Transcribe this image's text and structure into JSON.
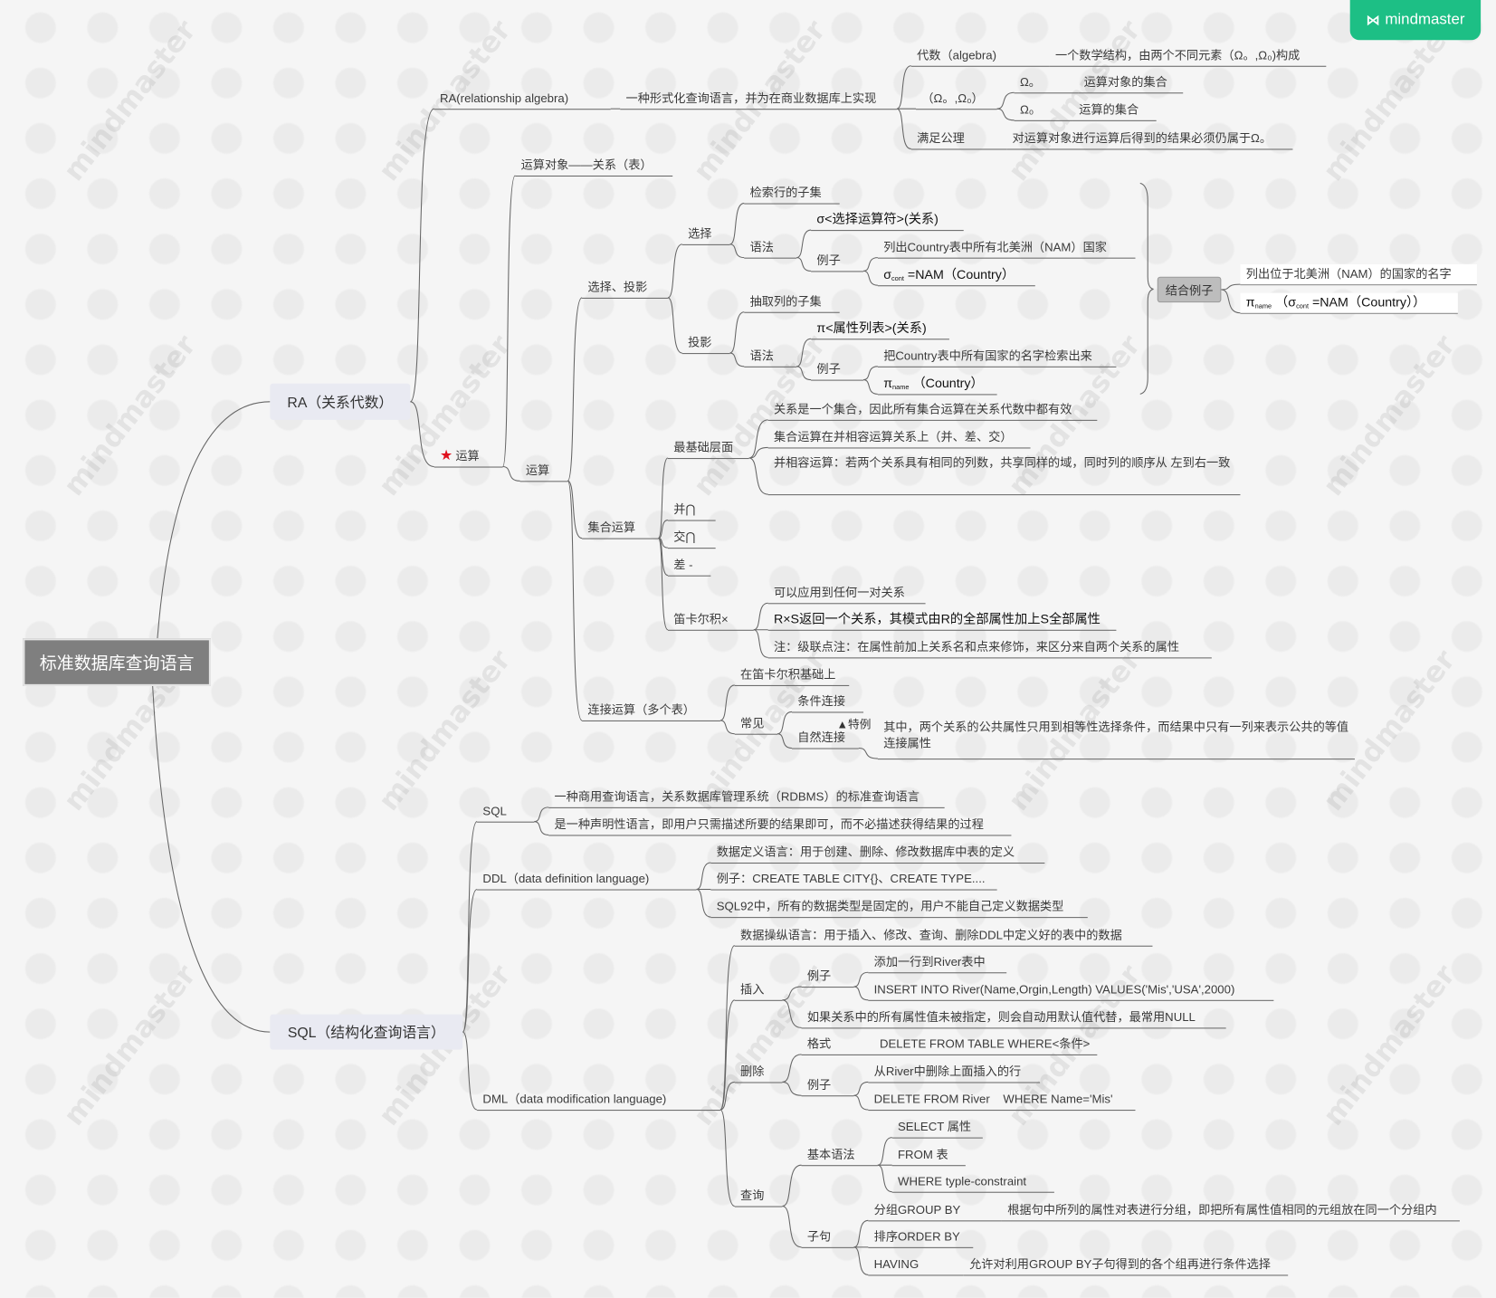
{
  "logo": {
    "text": "mindmaster",
    "icon": "mindmaster-logo-icon",
    "color": "#1dbf85"
  },
  "watermark": "mindmaster",
  "root": "标准数据库查询语言",
  "ra": {
    "label": "RA（关系代数）",
    "definition": {
      "label": "RA(relationship algebra)",
      "desc": "一种形式化查询语言，并为在商业数据库上实现",
      "algebra": {
        "label": "代数（algebra)",
        "desc": "一个数学结构，由两个不同元素（Ω。,Ω₀)构成"
      },
      "pair": {
        "label": "（Ω。,Ω₀）",
        "omega_a": {
          "symbol": "Ω。",
          "desc": "运算对象的集合"
        },
        "omega_0": {
          "symbol": "Ω₀",
          "desc": "运算的集合"
        }
      },
      "axiom": {
        "label": "满足公理",
        "desc": "对运算对象进行运算后得到的结果必须仍属于Ω。"
      }
    },
    "operations": {
      "label": "运算",
      "icon": "star-icon",
      "star_color": "#e0101d",
      "operand": "运算对象——关系（表）",
      "op": {
        "label": "运算",
        "select_project": {
          "label": "选择、投影",
          "select": {
            "label": "选择",
            "subset": "检索行的子集",
            "syntax": {
              "label": "语法",
              "formula": "σ<选择运算符>(关系)",
              "example": {
                "label": "例子",
                "desc": "列出Country表中所有北美洲（NAM）国家",
                "formula": {
                  "symbol": "σ",
                  "sub": "cont",
                  "rest": " =NAM（Country）"
                }
              }
            }
          },
          "project": {
            "label": "投影",
            "subset": "抽取列的子集",
            "syntax": {
              "label": "语法",
              "formula": "π<属性列表>(关系)",
              "example": {
                "label": "例子",
                "desc": "把Country表中所有国家的名字检索出来",
                "formula": {
                  "symbol": "π",
                  "sub": "name",
                  "rest": " （Country）"
                }
              }
            }
          },
          "combined": {
            "label": "结合例子",
            "desc": "列出位于北美洲（NAM）的国家的名字",
            "formula": {
              "symbol": "π",
              "sub": "name",
              "mid": " （σ",
              "sub2": "cont",
              "rest": " =NAM（Country））"
            }
          }
        },
        "set_ops": {
          "label": "集合运算",
          "basic": {
            "label": "最基础层面",
            "items": [
              "关系是一个集合，因此所有集合运算在关系代数中都有效",
              "集合运算在并相容运算关系上（并、差、交）",
              "并相容运算：若两个关系具有相同的列数，共享同样的域，同时列的顺序从 左到右一致"
            ]
          },
          "union": "并⋂",
          "intersect": "交⋂",
          "difference": "差 -",
          "cartesian": {
            "label": "笛卡尔积×",
            "items": [
              "可以应用到任何一对关系",
              "R×S返回一个关系，其模式由R的全部属性加上S全部属性",
              "注：级联点注：在属性前加上关系名和点来修饰，来区分来自两个关系的属性"
            ]
          }
        },
        "join": {
          "label": "连接运算（多个表）",
          "base": "在笛卡尔积基础上",
          "common": {
            "label": "常见",
            "conditional": "条件连接",
            "natural": "自然连接",
            "special_note": "▲特例",
            "natural_desc": "其中，两个关系的公共属性只用到相等性选择条件，而结果中只有一列来表示公共的等值连接属性"
          }
        }
      }
    }
  },
  "sql": {
    "label": "SQL（结构化查询语言）",
    "sql": {
      "label": "SQL",
      "items": [
        "一种商用查询语言，关系数据库管理系统（RDBMS）的标准查询语言",
        "是一种声明性语言，即用户只需描述所要的结果即可，而不必描述获得结果的过程"
      ]
    },
    "ddl": {
      "label": "DDL（data definition language)",
      "items": [
        "数据定义语言：用于创建、删除、修改数据库中表的定义",
        "例子：CREATE TABLE CITY{}、CREATE TYPE....",
        "SQL92中，所有的数据类型是固定的，用户不能自己定义数据类型"
      ]
    },
    "dml": {
      "label": "DML（data modification language)",
      "desc": "数据操纵语言：用于插入、修改、查询、删除DDL中定义好的表中的数据",
      "insert": {
        "label": "插入",
        "example": {
          "label": "例子",
          "items": [
            "添加一行到River表中",
            "INSERT INTO River(Name,Orgin,Length) VALUES('Mis','USA',2000)"
          ]
        },
        "note": "如果关系中的所有属性值未被指定，则会自动用默认值代替，最常用NULL"
      },
      "delete": {
        "label": "删除",
        "format": {
          "label": "格式",
          "desc": "DELETE FROM TABLE WHERE<条件>"
        },
        "example": {
          "label": "例子",
          "items": [
            "从River中删除上面插入的行",
            "DELETE FROM River    WHERE Name='Mis'"
          ]
        }
      },
      "query": {
        "label": "查询",
        "basic": {
          "label": "基本语法",
          "items": [
            "SELECT 属性",
            "FROM 表",
            "WHERE typle-constraint"
          ]
        },
        "clause": {
          "label": "子句",
          "group": {
            "label": "分组GROUP BY",
            "desc": "根据句中所列的属性对表进行分组，即把所有属性值相同的元组放在同一个分组内"
          },
          "order": {
            "label": "排序ORDER BY"
          },
          "having": {
            "label": "HAVING",
            "desc": "允许对利用GROUP BY子句得到的各个组再进行条件选择"
          }
        }
      }
    }
  }
}
